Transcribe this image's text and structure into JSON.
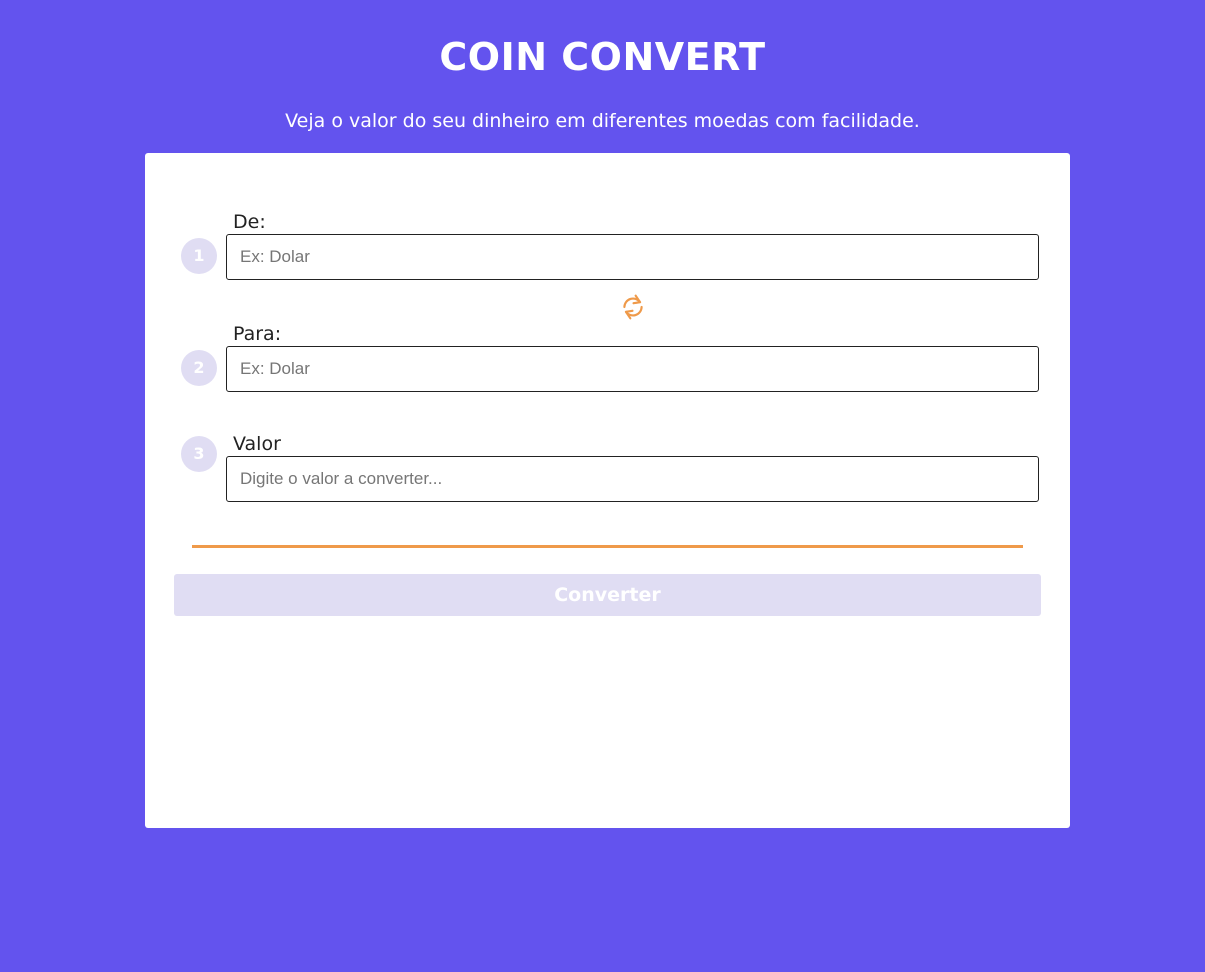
{
  "header": {
    "title": "COIN CONVERT",
    "subtitle": "Veja o valor do seu dinheiro em diferentes moedas com facilidade."
  },
  "form": {
    "from": {
      "step": "1",
      "label": "De:",
      "placeholder": "Ex: Dolar"
    },
    "to": {
      "step": "2",
      "label": "Para:",
      "placeholder": "Ex: Dolar"
    },
    "amount": {
      "step": "3",
      "label": "Valor",
      "placeholder": "Digite o valor a converter..."
    },
    "swap_icon": "swap-arrows-icon",
    "submit_label": "Converter"
  },
  "colors": {
    "background": "#6353ee",
    "accent": "#ef9a4a",
    "button_disabled": "#e0ddf3",
    "card": "#ffffff"
  }
}
